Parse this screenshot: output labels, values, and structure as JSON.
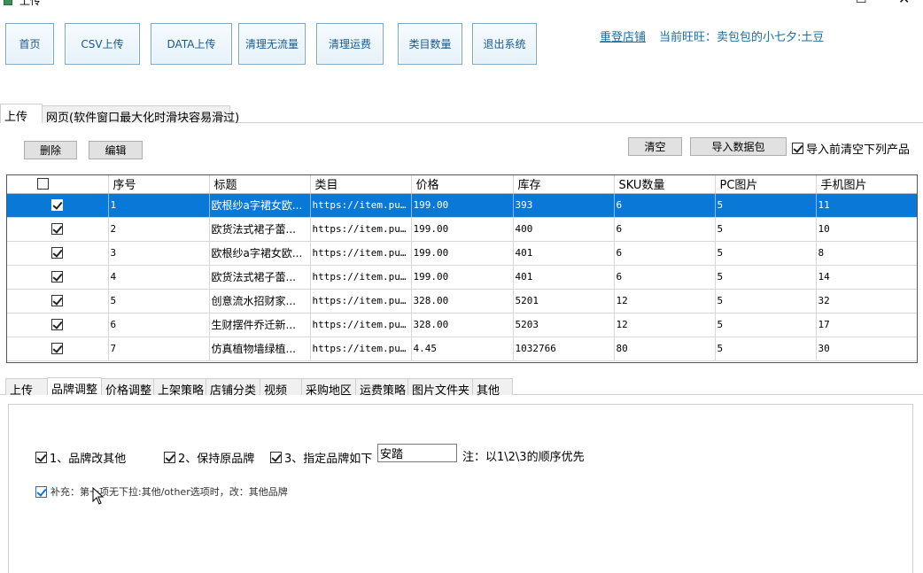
{
  "window": {
    "title": "上传"
  },
  "nav": {
    "buttons": [
      "首页",
      "CSV上传",
      "DATA上传",
      "清理无流量",
      "清理运费",
      "类目数量",
      "退出系统"
    ]
  },
  "header": {
    "relogin": "重登店铺",
    "current_user": "当前旺旺：卖包包的小七夕:土豆"
  },
  "upper_tabs": [
    "上传",
    "网页(软件窗口最大化时滑块容易滑过)"
  ],
  "actions": {
    "delete": "删除",
    "edit": "编辑",
    "clear": "清空",
    "import": "导入数据包",
    "clear_before_import": "导入前清空下列产品"
  },
  "grid": {
    "columns": [
      "",
      "序号",
      "标题",
      "类目",
      "价格",
      "库存",
      "SKU数量",
      "PC图片",
      "手机图片"
    ],
    "rows": [
      {
        "checked": true,
        "selected": true,
        "no": "1",
        "title": "欧根纱a字裙女欧...",
        "category": "https://item.pu...",
        "price": "199.00",
        "stock": "393",
        "sku": "6",
        "pc": "5",
        "mobile": "11"
      },
      {
        "checked": true,
        "selected": false,
        "no": "2",
        "title": "欧货法式裙子蕾...",
        "category": "https://item.pu...",
        "price": "199.00",
        "stock": "400",
        "sku": "6",
        "pc": "5",
        "mobile": "10"
      },
      {
        "checked": true,
        "selected": false,
        "no": "3",
        "title": "欧根纱a字裙女欧...",
        "category": "https://item.pu...",
        "price": "199.00",
        "stock": "401",
        "sku": "6",
        "pc": "5",
        "mobile": "8"
      },
      {
        "checked": true,
        "selected": false,
        "no": "4",
        "title": "欧货法式裙子蕾...",
        "category": "https://item.pu...",
        "price": "199.00",
        "stock": "401",
        "sku": "6",
        "pc": "5",
        "mobile": "14"
      },
      {
        "checked": true,
        "selected": false,
        "no": "5",
        "title": "创意流水招财家...",
        "category": "https://item.pu...",
        "price": "328.00",
        "stock": "5201",
        "sku": "12",
        "pc": "5",
        "mobile": "32"
      },
      {
        "checked": true,
        "selected": false,
        "no": "6",
        "title": "生财摆件乔迁新...",
        "category": "https://item.pu...",
        "price": "328.00",
        "stock": "5203",
        "sku": "12",
        "pc": "5",
        "mobile": "17"
      },
      {
        "checked": true,
        "selected": false,
        "no": "7",
        "title": "仿真植物墙绿植...",
        "category": "https://item.pu...",
        "price": "4.45",
        "stock": "1032766",
        "sku": "80",
        "pc": "5",
        "mobile": "30"
      }
    ]
  },
  "lower_tabs": [
    "上传",
    "品牌调整",
    "价格调整",
    "上架策略",
    "店铺分类",
    "视频",
    "采购地区",
    "运费策略",
    "图片文件夹",
    "其他"
  ],
  "brand_panel": {
    "opt1": "1、品牌改其他",
    "opt2": "2、保持原品牌",
    "opt3": "3、指定品牌如下",
    "brand_value": "安踏",
    "note": "注：以1\\2\\3的顺序优先",
    "supplement": "补充：第一项无下拉:其他/other选项时，改：其他品牌"
  },
  "colors": {
    "selection": "#0a78d7",
    "nav_text": "#1a5a8a",
    "link": "#1a6ea0"
  }
}
